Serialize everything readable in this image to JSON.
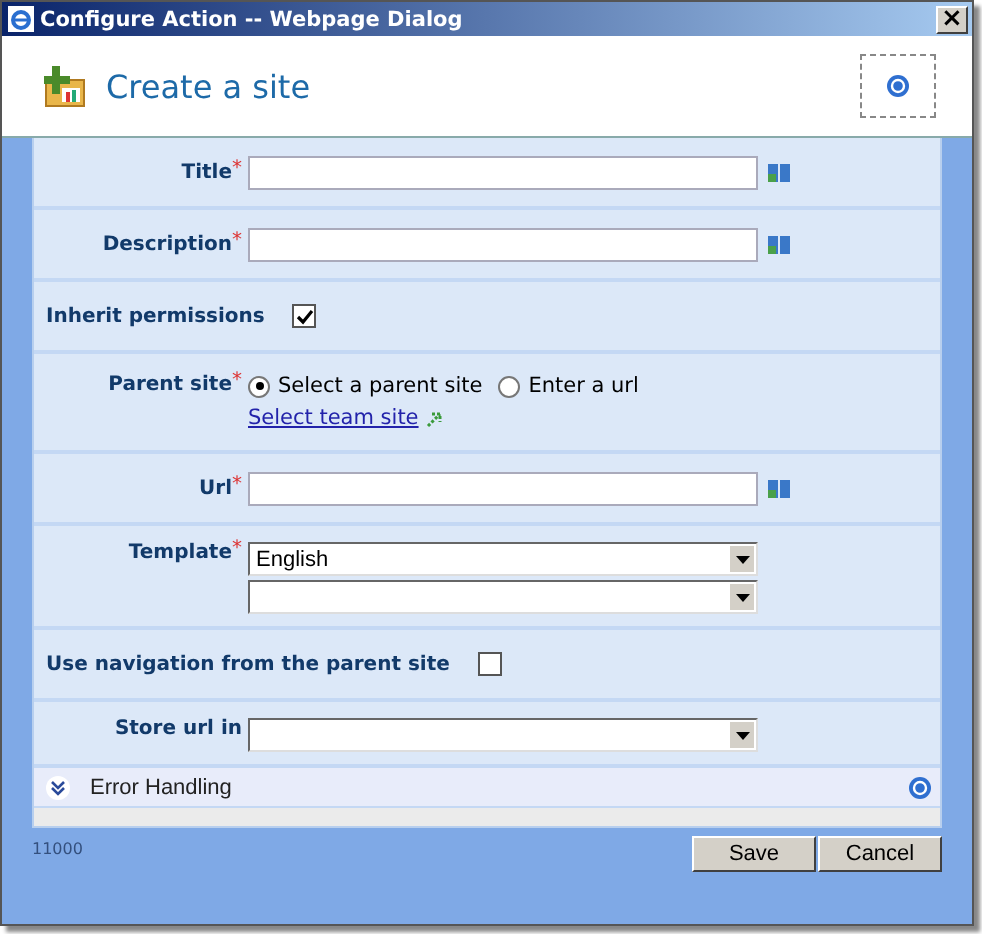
{
  "window": {
    "title": "Configure Action -- Webpage Dialog",
    "close": "×"
  },
  "header": {
    "title": "Create a site"
  },
  "rows": [
    {
      "kind": "text",
      "label": "Title",
      "required_mark": "*"
    },
    {
      "kind": "text",
      "label": "Description",
      "required_mark": "*"
    },
    {
      "kind": "checkbox",
      "label": "Inherit permissions",
      "checked": true
    },
    {
      "kind": "radio",
      "label": "Parent site",
      "required_mark": "*",
      "options": [
        {
          "label": "Select a parent site",
          "selected": true
        },
        {
          "label": "Enter a url",
          "selected": false
        }
      ],
      "link": "Select team site"
    },
    {
      "kind": "text",
      "label": "Url",
      "required_mark": "*"
    },
    {
      "kind": "select",
      "label": "Template",
      "required_mark": "*",
      "dropdowns": [
        {
          "kind": "filled",
          "value": "English"
        },
        {
          "kind": "empty"
        }
      ]
    },
    {
      "kind": "checkbox",
      "label": "Use navigation from the parent site",
      "checked": false
    },
    {
      "kind": "select",
      "label": "Store url in",
      "dropdowns": [
        {
          "kind": "empty"
        }
      ]
    }
  ],
  "section": {
    "label": "Error Handling",
    "expanded": false
  },
  "footer": {
    "code": "11000",
    "buttons": [
      "Save",
      "Cancel"
    ]
  }
}
